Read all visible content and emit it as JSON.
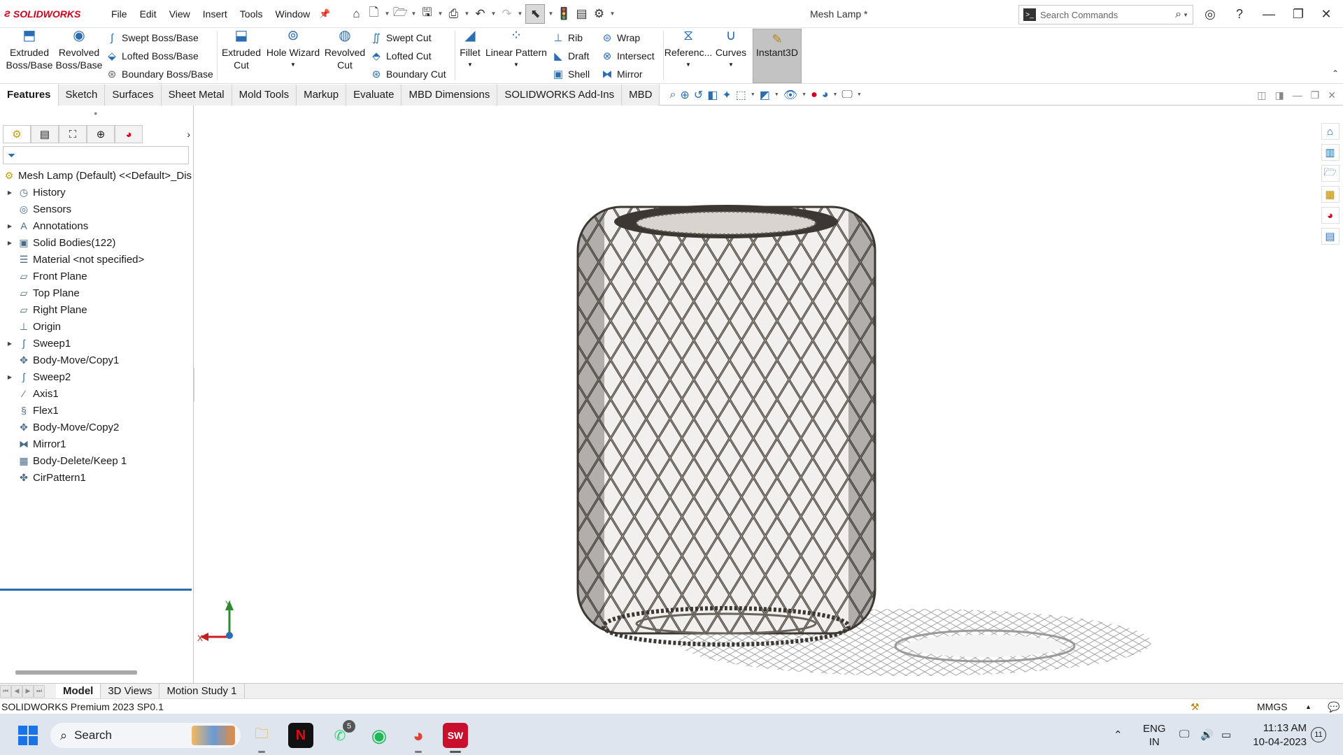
{
  "app": {
    "logo_text": "SOLIDWORKS",
    "document_title": "Mesh Lamp *",
    "menu": [
      "File",
      "Edit",
      "View",
      "Insert",
      "Tools",
      "Window"
    ],
    "search_placeholder": "Search Commands"
  },
  "command_manager": {
    "extruded_boss": "Extruded\nBoss/Base",
    "revolved_boss": "Revolved\nBoss/Base",
    "swept_boss": "Swept Boss/Base",
    "lofted_boss": "Lofted Boss/Base",
    "boundary_boss": "Boundary Boss/Base",
    "extruded_cut": "Extruded\nCut",
    "hole_wizard": "Hole Wizard",
    "revolved_cut": "Revolved\nCut",
    "swept_cut": "Swept Cut",
    "lofted_cut": "Lofted Cut",
    "boundary_cut": "Boundary Cut",
    "fillet": "Fillet",
    "linear_pattern": "Linear Pattern",
    "rib": "Rib",
    "draft": "Draft",
    "shell": "Shell",
    "wrap": "Wrap",
    "intersect": "Intersect",
    "mirror": "Mirror",
    "reference": "Referenc...",
    "curves": "Curves",
    "instant3d": "Instant3D"
  },
  "tabs": [
    "Features",
    "Sketch",
    "Surfaces",
    "Sheet Metal",
    "Mold Tools",
    "Markup",
    "Evaluate",
    "MBD Dimensions",
    "SOLIDWORKS Add-Ins",
    "MBD"
  ],
  "feature_tree": {
    "root": "Mesh Lamp (Default) <<Default>_Dis",
    "items": [
      {
        "label": "History",
        "expandable": true,
        "icon": "history-icon"
      },
      {
        "label": "Sensors",
        "expandable": false,
        "icon": "sensor-icon"
      },
      {
        "label": "Annotations",
        "expandable": true,
        "icon": "annotation-icon"
      },
      {
        "label": "Solid Bodies(122)",
        "expandable": true,
        "icon": "solid-bodies-icon"
      },
      {
        "label": "Material <not specified>",
        "expandable": false,
        "icon": "material-icon"
      },
      {
        "label": "Front Plane",
        "expandable": false,
        "icon": "plane-icon"
      },
      {
        "label": "Top Plane",
        "expandable": false,
        "icon": "plane-icon"
      },
      {
        "label": "Right Plane",
        "expandable": false,
        "icon": "plane-icon"
      },
      {
        "label": "Origin",
        "expandable": false,
        "icon": "origin-icon"
      },
      {
        "label": "Sweep1",
        "expandable": true,
        "icon": "sweep-icon"
      },
      {
        "label": "Body-Move/Copy1",
        "expandable": false,
        "icon": "move-copy-icon"
      },
      {
        "label": "Sweep2",
        "expandable": true,
        "icon": "sweep-icon"
      },
      {
        "label": "Axis1",
        "expandable": false,
        "icon": "axis-icon"
      },
      {
        "label": "Flex1",
        "expandable": false,
        "icon": "flex-icon"
      },
      {
        "label": "Body-Move/Copy2",
        "expandable": false,
        "icon": "move-copy-icon"
      },
      {
        "label": "Mirror1",
        "expandable": false,
        "icon": "mirror-icon"
      },
      {
        "label": "Body-Delete/Keep 1",
        "expandable": false,
        "icon": "body-delete-icon"
      },
      {
        "label": "CirPattern1",
        "expandable": false,
        "icon": "circular-pattern-icon"
      }
    ]
  },
  "triad": {
    "y": "Y",
    "x": "X"
  },
  "bottom_tabs": [
    "Model",
    "3D Views",
    "Motion Study 1"
  ],
  "status": {
    "product": "SOLIDWORKS Premium 2023 SP0.1",
    "units": "MMGS"
  },
  "taskbar": {
    "search": "Search",
    "whatsapp_badge": "5",
    "lang_line1": "ENG",
    "lang_line2": "IN",
    "time": "11:13 AM",
    "date": "10-04-2023",
    "notifications": "11"
  },
  "colors": {
    "brand_red": "#d6001c",
    "accent_blue": "#2a6db3",
    "selection_blue": "#2a6db3"
  }
}
